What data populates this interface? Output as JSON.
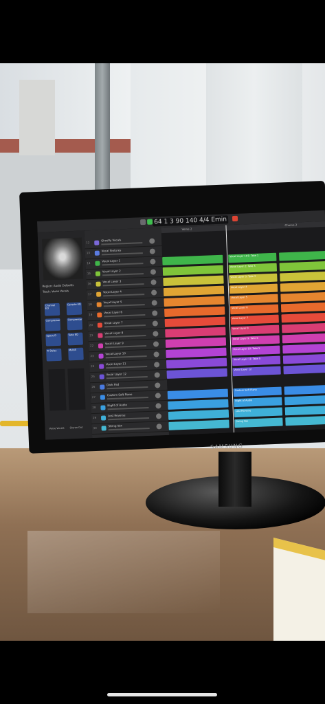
{
  "screen": {
    "lcd": "64  1  3  90  140  4/4  Emin",
    "monitor_brand": "SAMSUNG",
    "inspector": {
      "region": "Region: Audio Defaults",
      "track": "Track: Verse Vocals",
      "plugins": [
        "Channel EQ",
        "Compressor",
        "Space D",
        "Tr Delay",
        "Console EQ",
        "Compressor",
        "Tube EQ",
        "MultiS"
      ],
      "strip_labels": [
        "Verse Vocals",
        "Stereo Out"
      ]
    },
    "tracks": [
      {
        "num": "12",
        "name": "Ghostly Vocals",
        "color": "#7b68d8"
      },
      {
        "num": "13",
        "name": "Vocal Textures",
        "color": "#5b7be0"
      },
      {
        "num": "14",
        "name": "Vocal Layer 1",
        "color": "#3fb54a"
      },
      {
        "num": "15",
        "name": "Vocal Layer 2",
        "color": "#7fc53a"
      },
      {
        "num": "16",
        "name": "Vocal Layer 3",
        "color": "#c9c23a"
      },
      {
        "num": "17",
        "name": "Vocal Layer 4",
        "color": "#e0a534"
      },
      {
        "num": "18",
        "name": "Vocal Layer 5",
        "color": "#e6862f"
      },
      {
        "num": "19",
        "name": "Vocal Layer 6",
        "color": "#e86a2c"
      },
      {
        "num": "20",
        "name": "Vocal Layer 7",
        "color": "#e64b3a"
      },
      {
        "num": "21",
        "name": "Vocal Layer 8",
        "color": "#d93d74"
      },
      {
        "num": "22",
        "name": "Vocal Layer 9",
        "color": "#cf3fb0"
      },
      {
        "num": "23",
        "name": "Vocal Layer 10",
        "color": "#b343d4"
      },
      {
        "num": "24",
        "name": "Vocal Layer 11",
        "color": "#8a4ad8"
      },
      {
        "num": "25",
        "name": "Vocal Layer 12",
        "color": "#6c54d6"
      },
      {
        "num": "26",
        "name": "Dark Pad",
        "color": "#4a7be0"
      },
      {
        "num": "27",
        "name": "Custom Soft Piano",
        "color": "#3a8de6"
      },
      {
        "num": "28",
        "name": "Night of Audio",
        "color": "#3aa0e0"
      },
      {
        "num": "29",
        "name": "Lost Reverse",
        "color": "#3fb0d8"
      },
      {
        "num": "30",
        "name": "String Vox",
        "color": "#45b8d2"
      }
    ],
    "regions": [
      {
        "track": 2,
        "label": "Vocal Layer 1#1: Take 1",
        "color": "#3fb54a"
      },
      {
        "track": 3,
        "label": "Vocal Layer 2: Take 5",
        "color": "#7fc53a"
      },
      {
        "track": 4,
        "label": "Vocal Layer 3: Take 3",
        "color": "#c9c23a"
      },
      {
        "track": 5,
        "label": "Vocal Layer 4",
        "color": "#e0a534"
      },
      {
        "track": 6,
        "label": "Vocal Layer 5",
        "color": "#e6862f"
      },
      {
        "track": 7,
        "label": "Vocal Layer 6",
        "color": "#e86a2c"
      },
      {
        "track": 8,
        "label": "Vocal Layer 7",
        "color": "#e64b3a"
      },
      {
        "track": 9,
        "label": "Vocal Layer 8",
        "color": "#d93d74"
      },
      {
        "track": 10,
        "label": "Vocal Layer 9: Take 6",
        "color": "#cf3fb0"
      },
      {
        "track": 11,
        "label": "Vocal Layer 10: Take 5",
        "color": "#b343d4"
      },
      {
        "track": 12,
        "label": "Vocal Layer 11: Take 5",
        "color": "#8a4ad8"
      },
      {
        "track": 13,
        "label": "Vocal Layer 12",
        "color": "#6c54d6"
      },
      {
        "track": 15,
        "label": "Custom Soft Piano",
        "color": "#3a8de6"
      },
      {
        "track": 16,
        "label": "Night of Audio",
        "color": "#3aa0e0"
      },
      {
        "track": 17,
        "label": "Lost Reverse",
        "color": "#3fb0d8"
      },
      {
        "track": 18,
        "label": "String Vox",
        "color": "#45b8d2"
      }
    ],
    "ruler_labels": [
      "Verse 2",
      "Chorus 2"
    ]
  }
}
